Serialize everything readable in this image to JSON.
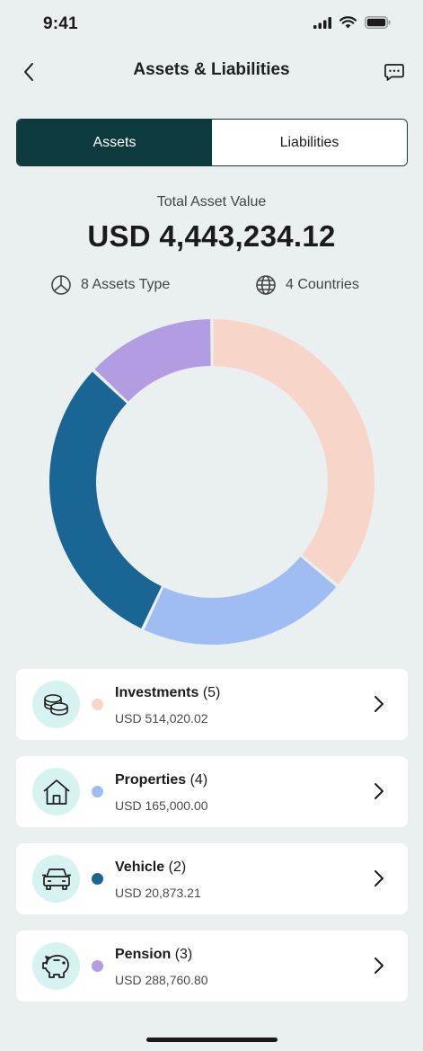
{
  "status_bar": {
    "time": "9:41"
  },
  "header": {
    "title": "Assets & Liabilities"
  },
  "segment": {
    "assets_label": "Assets",
    "liabilities_label": "Liabilities",
    "selected": "Assets"
  },
  "summary": {
    "total_label": "Total Asset Value",
    "total_value": "USD 4,443,234.12",
    "asset_types": "8 Assets Type",
    "countries": "4 Countries"
  },
  "colors": {
    "investments": "#F8D5C9",
    "properties": "#A0BDF3",
    "vehicle": "#196694",
    "pension": "#B29DE3",
    "primary": "#0D3A3D",
    "icon_bg": "#D6F3F1"
  },
  "chart_data": {
    "type": "pie",
    "series": [
      {
        "name": "Investments",
        "share": 0.36
      },
      {
        "name": "Properties",
        "share": 0.21
      },
      {
        "name": "Vehicle",
        "share": 0.3
      },
      {
        "name": "Pension",
        "share": 0.13
      }
    ]
  },
  "list": {
    "items": [
      {
        "icon": "coins-icon",
        "name": "Investments",
        "count": "(5)",
        "amount": "USD 514,020.02",
        "color": "#F8D5C9"
      },
      {
        "icon": "house-icon",
        "name": "Properties",
        "count": "(4)",
        "amount": "USD 165,000.00",
        "color": "#A0BDF3"
      },
      {
        "icon": "car-icon",
        "name": "Vehicle",
        "count": "(2)",
        "amount": "USD 20,873.21",
        "color": "#196694"
      },
      {
        "icon": "piggy-bank-icon",
        "name": "Pension",
        "count": "(3)",
        "amount": "USD 288,760.80",
        "color": "#B29DE3"
      }
    ]
  }
}
